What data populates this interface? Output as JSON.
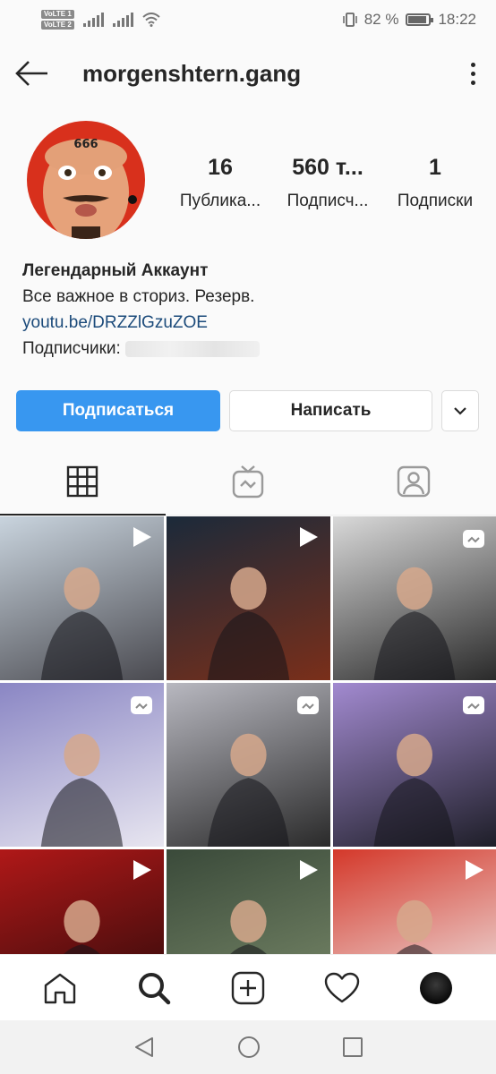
{
  "status_bar": {
    "volte_1": "VoLTE 1",
    "volte_2": "VoLTE 2",
    "battery": "82 %",
    "time": "18:22"
  },
  "header": {
    "username": "morgenshtern.gang",
    "back_icon": "arrow-left-icon",
    "more_icon": "more-vertical-icon"
  },
  "profile": {
    "avatar_tattoo": "666",
    "stats": [
      {
        "value": "16",
        "label": "Публика..."
      },
      {
        "value": "560 т...",
        "label": "Подписч..."
      },
      {
        "value": "1",
        "label": "Подписки"
      }
    ]
  },
  "bio": {
    "name": "Легендарный Аккаунт",
    "text": "Все важное в сториз. Резерв.",
    "link": "youtu.be/DRZZlGzuZOE",
    "followers_prefix": "Подписчики:"
  },
  "actions": {
    "follow": "Подписаться",
    "message": "Написать",
    "dropdown_icon": "chevron-down-icon"
  },
  "tabs": [
    {
      "name": "grid",
      "icon": "grid-icon",
      "active": true
    },
    {
      "name": "igtv",
      "icon": "igtv-icon",
      "active": false
    },
    {
      "name": "tagged",
      "icon": "tagged-user-icon",
      "active": false
    }
  ],
  "posts": [
    {
      "type": "video",
      "colors": [
        "#c9d4de",
        "#4a4a50"
      ]
    },
    {
      "type": "video",
      "colors": [
        "#1b2a3a",
        "#7a2f1a"
      ]
    },
    {
      "type": "igtv",
      "colors": [
        "#d9d9d9",
        "#2a2a2a"
      ]
    },
    {
      "type": "igtv",
      "colors": [
        "#8a86c4",
        "#e8e6f0"
      ]
    },
    {
      "type": "igtv",
      "colors": [
        "#b8b8c0",
        "#2a2a2a"
      ]
    },
    {
      "type": "igtv",
      "colors": [
        "#a28ad0",
        "#1e1e28"
      ]
    },
    {
      "type": "video",
      "colors": [
        "#b01818",
        "#2a0a0a"
      ]
    },
    {
      "type": "video",
      "colors": [
        "#3a4a3a",
        "#7a8a6a"
      ]
    },
    {
      "type": "video",
      "colors": [
        "#d4382a",
        "#f0f0f0"
      ]
    }
  ],
  "bottom_nav": [
    "home-icon",
    "search-icon",
    "add-post-icon",
    "heart-icon",
    "profile-avatar"
  ],
  "system_nav": [
    "back-triangle-icon",
    "home-circle-icon",
    "recents-square-icon"
  ]
}
